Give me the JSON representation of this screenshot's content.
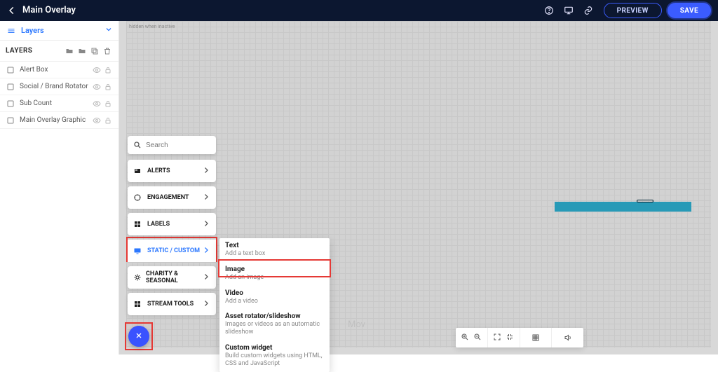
{
  "header": {
    "title": "Main Overlay",
    "preview": "PREVIEW",
    "save": "SAVE"
  },
  "sidebar": {
    "section_label": "Layers",
    "header_label": "LAYERS",
    "layers": [
      {
        "label": "Alert Box"
      },
      {
        "label": "Social / Brand Rotator"
      },
      {
        "label": "Sub Count"
      },
      {
        "label": "Main Overlay Graphic"
      }
    ]
  },
  "popover": {
    "search_placeholder": "Search",
    "categories": [
      {
        "label": "ALERTS"
      },
      {
        "label": "ENGAGEMENT"
      },
      {
        "label": "LABELS"
      },
      {
        "label": "STATIC / CUSTOM",
        "active": true
      },
      {
        "label": "CHARITY & SEASONAL"
      },
      {
        "label": "STREAM TOOLS"
      }
    ]
  },
  "submenu": {
    "items": [
      {
        "title": "Text",
        "desc": "Add a text box"
      },
      {
        "title": "Image",
        "desc": "Add an image"
      },
      {
        "title": "Video",
        "desc": "Add a video"
      },
      {
        "title": "Asset rotator/slideshow",
        "desc": "Images or videos as an automatic slideshow"
      },
      {
        "title": "Custom widget",
        "desc": "Build custom widgets using HTML, CSS and JavaScript"
      }
    ]
  },
  "canvas": {
    "tiny_hint": "hidden when inactive",
    "ghost": "Mov"
  },
  "colors": {
    "accent": "#3b5cff",
    "highlight": "#e53935",
    "selection": "#279ab7"
  }
}
